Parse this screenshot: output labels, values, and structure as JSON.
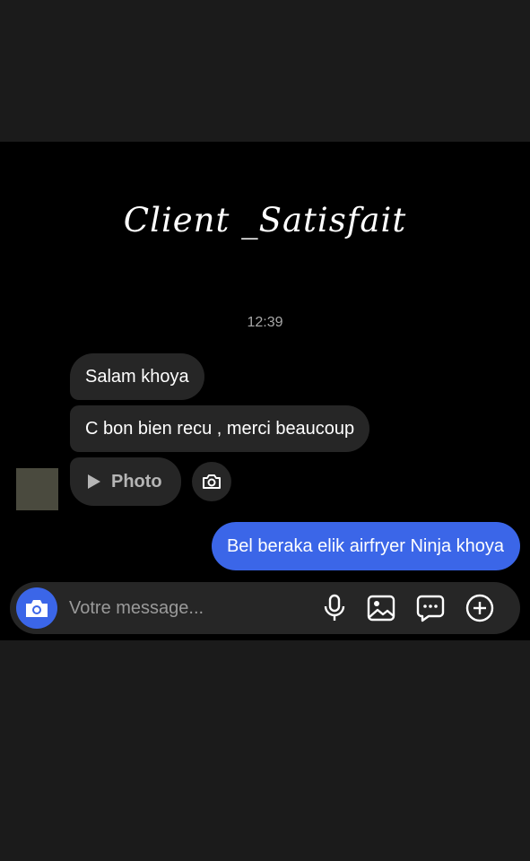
{
  "caption": "Client _Satisfait",
  "conversation": {
    "timestamp": "12:39",
    "received": [
      "Salam khoya",
      "C bon bien recu , merci beaucoup"
    ],
    "attachment_label": "Photo",
    "sent": "Bel beraka elik airfryer Ninja khoya"
  },
  "composer": {
    "placeholder": "Votre message..."
  },
  "icons": {
    "composer_camera": "camera-icon",
    "reply_camera": "camera-icon",
    "mic": "microphone-icon",
    "gallery": "image-icon",
    "sticker": "chat-bubble-icon",
    "more": "plus-circle-icon",
    "attachment_play": "play-icon"
  },
  "colors": {
    "accent": "#3b66e8",
    "received_bubble": "#262626",
    "background": "#000000",
    "frame": "#1b1b1b"
  }
}
